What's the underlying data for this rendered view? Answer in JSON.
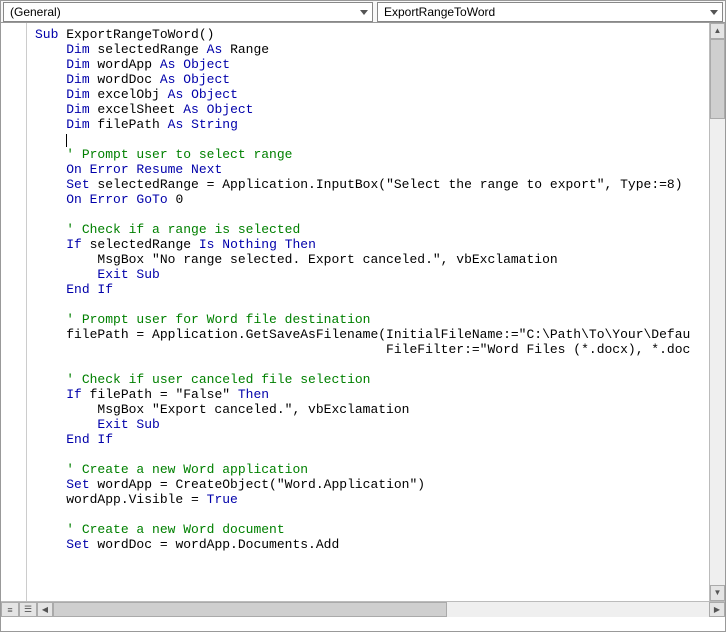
{
  "toolbar": {
    "scope_label": "(General)",
    "proc_label": "ExportRangeToWord"
  },
  "code": {
    "tokens": [
      [
        [
          "k",
          "Sub"
        ],
        [
          "p",
          " ExportRangeToWord()"
        ]
      ],
      [
        [
          "p",
          "    "
        ],
        [
          "k",
          "Dim"
        ],
        [
          "p",
          " selectedRange "
        ],
        [
          "k",
          "As"
        ],
        [
          "p",
          " Range"
        ]
      ],
      [
        [
          "p",
          "    "
        ],
        [
          "k",
          "Dim"
        ],
        [
          "p",
          " wordApp "
        ],
        [
          "k",
          "As"
        ],
        [
          "p",
          " "
        ],
        [
          "k",
          "Object"
        ]
      ],
      [
        [
          "p",
          "    "
        ],
        [
          "k",
          "Dim"
        ],
        [
          "p",
          " wordDoc "
        ],
        [
          "k",
          "As"
        ],
        [
          "p",
          " "
        ],
        [
          "k",
          "Object"
        ]
      ],
      [
        [
          "p",
          "    "
        ],
        [
          "k",
          "Dim"
        ],
        [
          "p",
          " excelObj "
        ],
        [
          "k",
          "As"
        ],
        [
          "p",
          " "
        ],
        [
          "k",
          "Object"
        ]
      ],
      [
        [
          "p",
          "    "
        ],
        [
          "k",
          "Dim"
        ],
        [
          "p",
          " excelSheet "
        ],
        [
          "k",
          "As"
        ],
        [
          "p",
          " "
        ],
        [
          "k",
          "Object"
        ]
      ],
      [
        [
          "p",
          "    "
        ],
        [
          "k",
          "Dim"
        ],
        [
          "p",
          " filePath "
        ],
        [
          "k",
          "As"
        ],
        [
          "p",
          " "
        ],
        [
          "k",
          "String"
        ]
      ],
      [
        [
          "cursor",
          "    "
        ]
      ],
      [
        [
          "p",
          "    "
        ],
        [
          "c",
          "' Prompt user to select range"
        ]
      ],
      [
        [
          "p",
          "    "
        ],
        [
          "k",
          "On Error Resume Next"
        ]
      ],
      [
        [
          "p",
          "    "
        ],
        [
          "k",
          "Set"
        ],
        [
          "p",
          " selectedRange = Application.InputBox(\"Select the range to export\", Type:=8)"
        ]
      ],
      [
        [
          "p",
          "    "
        ],
        [
          "k",
          "On Error GoTo"
        ],
        [
          "p",
          " 0"
        ]
      ],
      [
        [
          "p",
          ""
        ]
      ],
      [
        [
          "p",
          "    "
        ],
        [
          "c",
          "' Check if a range is selected"
        ]
      ],
      [
        [
          "p",
          "    "
        ],
        [
          "k",
          "If"
        ],
        [
          "p",
          " selectedRange "
        ],
        [
          "k",
          "Is"
        ],
        [
          "p",
          " "
        ],
        [
          "k",
          "Nothing"
        ],
        [
          "p",
          " "
        ],
        [
          "k",
          "Then"
        ]
      ],
      [
        [
          "p",
          "        MsgBox \"No range selected. Export canceled.\", vbExclamation"
        ]
      ],
      [
        [
          "p",
          "        "
        ],
        [
          "k",
          "Exit Sub"
        ]
      ],
      [
        [
          "p",
          "    "
        ],
        [
          "k",
          "End If"
        ]
      ],
      [
        [
          "p",
          ""
        ]
      ],
      [
        [
          "p",
          "    "
        ],
        [
          "c",
          "' Prompt user for Word file destination"
        ]
      ],
      [
        [
          "p",
          "    filePath = Application.GetSaveAsFilename(InitialFileName:=\"C:\\Path\\To\\Your\\Defau"
        ]
      ],
      [
        [
          "p",
          "                                             FileFilter:=\"Word Files (*.docx), *.doc"
        ]
      ],
      [
        [
          "p",
          ""
        ]
      ],
      [
        [
          "p",
          "    "
        ],
        [
          "c",
          "' Check if user canceled file selection"
        ]
      ],
      [
        [
          "p",
          "    "
        ],
        [
          "k",
          "If"
        ],
        [
          "p",
          " filePath = \"False\" "
        ],
        [
          "k",
          "Then"
        ]
      ],
      [
        [
          "p",
          "        MsgBox \"Export canceled.\", vbExclamation"
        ]
      ],
      [
        [
          "p",
          "        "
        ],
        [
          "k",
          "Exit Sub"
        ]
      ],
      [
        [
          "p",
          "    "
        ],
        [
          "k",
          "End If"
        ]
      ],
      [
        [
          "p",
          ""
        ]
      ],
      [
        [
          "p",
          "    "
        ],
        [
          "c",
          "' Create a new Word application"
        ]
      ],
      [
        [
          "p",
          "    "
        ],
        [
          "k",
          "Set"
        ],
        [
          "p",
          " wordApp = CreateObject(\"Word.Application\")"
        ]
      ],
      [
        [
          "p",
          "    wordApp.Visible = "
        ],
        [
          "k",
          "True"
        ]
      ],
      [
        [
          "p",
          ""
        ]
      ],
      [
        [
          "p",
          "    "
        ],
        [
          "c",
          "' Create a new Word document"
        ]
      ],
      [
        [
          "p",
          "    "
        ],
        [
          "k",
          "Set"
        ],
        [
          "p",
          " wordDoc = wordApp.Documents.Add"
        ]
      ]
    ]
  }
}
